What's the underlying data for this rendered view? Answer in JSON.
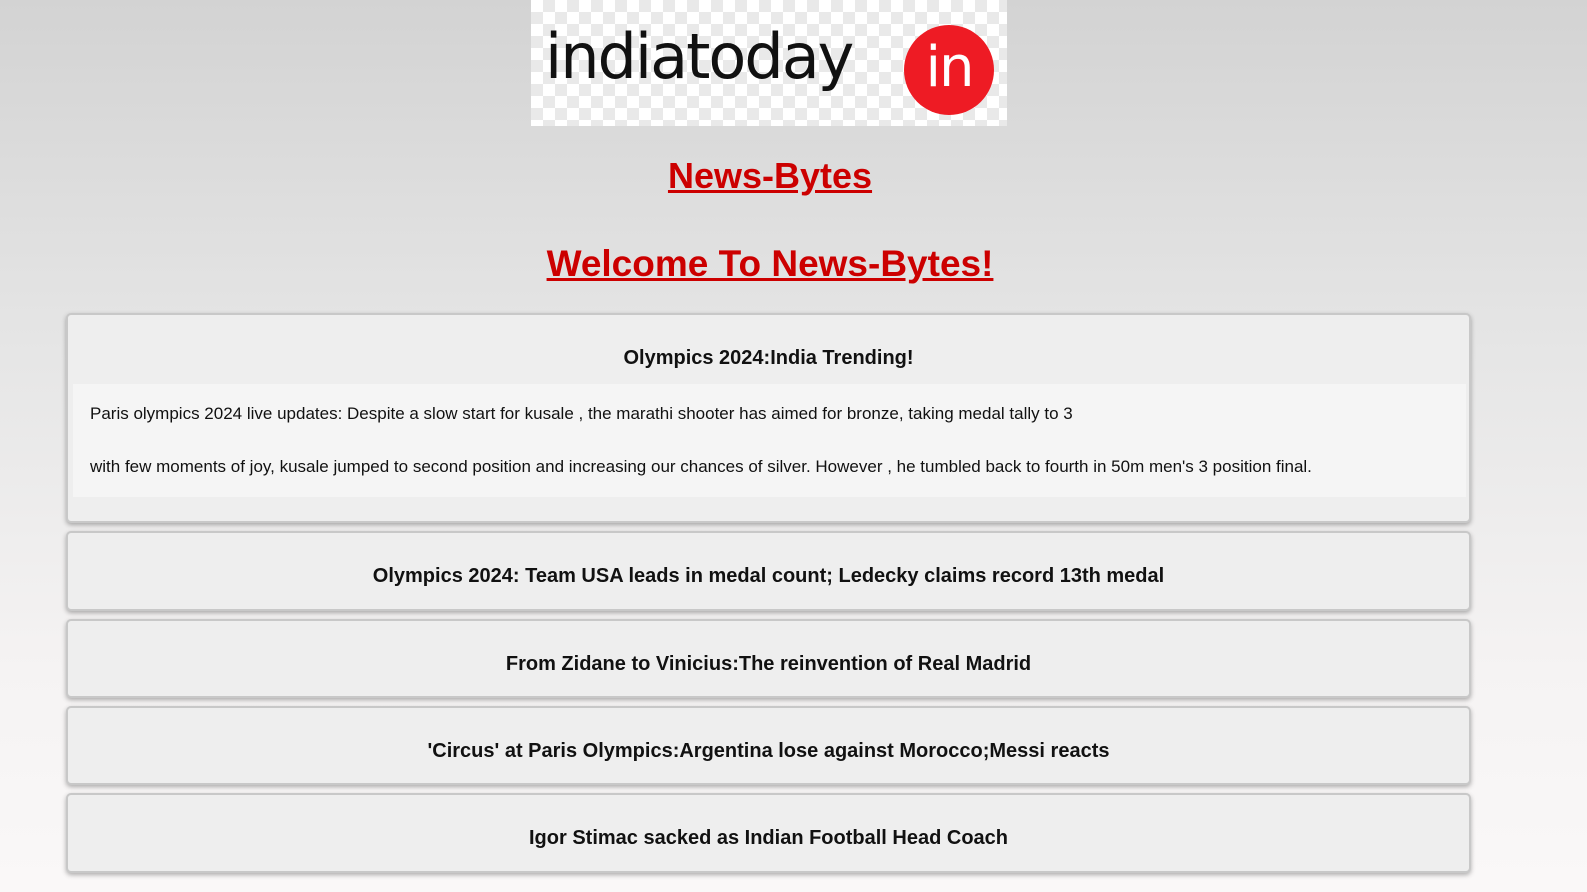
{
  "logo": {
    "text": "indiatoday",
    "badge": "in"
  },
  "brand_heading": "News-Bytes",
  "welcome_heading": "Welcome To News-Bytes!",
  "articles": [
    {
      "title": "Olympics 2024:India Trending!",
      "paragraphs": [
        "Paris olympics 2024 live updates: Despite a slow start for kusale , the marathi shooter has aimed for bronze, taking medal tally to 3",
        "with few moments of joy, kusale jumped to second position and increasing our chances of silver. However , he tumbled back to fourth in 50m men's 3 position final."
      ]
    },
    {
      "title": "Olympics 2024: Team USA leads in medal count; Ledecky claims record 13th medal"
    },
    {
      "title": "From Zidane to Vinicius:The reinvention of Real Madrid"
    },
    {
      "title": "'Circus' at Paris Olympics:Argentina lose against Morocco;Messi reacts"
    },
    {
      "title": "Igor Stimac sacked as Indian Football Head Coach"
    }
  ],
  "colors": {
    "heading": "#cc0000",
    "logo_badge": "#ee1b24"
  }
}
